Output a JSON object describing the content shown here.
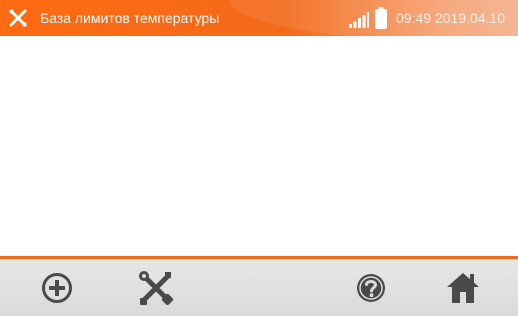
{
  "header": {
    "icon": "wrench-screwdriver-icon",
    "title": "База лимитов температуры",
    "time": "09:49 2019.04.10",
    "signal_icon": "signal-strength-icon",
    "battery_icon": "battery-icon"
  },
  "toolbar": {
    "buttons": [
      {
        "name": "add",
        "icon": "plus-circle-icon"
      },
      {
        "name": "settings",
        "icon": "wrench-screwdriver-icon"
      },
      {
        "name": "help",
        "icon": "question-circle-icon"
      },
      {
        "name": "home",
        "icon": "home-icon"
      }
    ]
  },
  "colors": {
    "accent": "#ff6a12",
    "toolbar": "#dedede",
    "icon": "#4a4a4a"
  }
}
